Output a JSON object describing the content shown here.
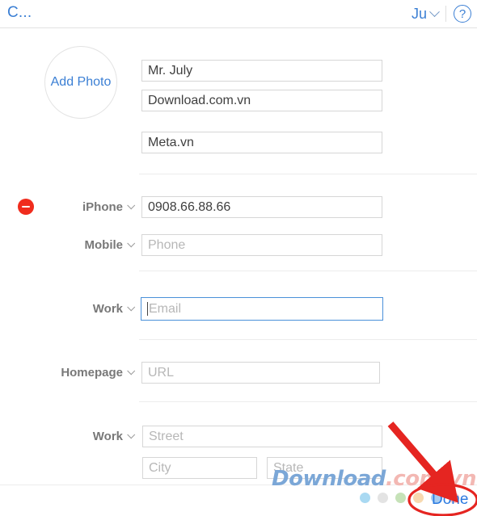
{
  "header": {
    "title": "C...",
    "account_label": "Ju",
    "account_chevron_icon": "chevron-down-icon",
    "help_icon": "help-circle-icon"
  },
  "photo": {
    "label": "Add Photo"
  },
  "name_fields": [
    {
      "name": "first-name-field",
      "value": "Mr. July"
    },
    {
      "name": "last-name-field",
      "value": "Download.com.vn"
    },
    {
      "name": "company-field",
      "value": "Meta.vn"
    }
  ],
  "phone_section": {
    "delete_icon": "minus-circle-icon",
    "rows": [
      {
        "label": "iPhone",
        "value": "0908.66.88.66",
        "placeholder": "",
        "is_placeholder": false
      },
      {
        "label": "Mobile",
        "value": "Phone",
        "placeholder": "Phone",
        "is_placeholder": true
      }
    ]
  },
  "email_section": {
    "rows": [
      {
        "label": "Work",
        "value": "Email",
        "placeholder": "Email",
        "is_placeholder": true,
        "focused": true
      }
    ]
  },
  "url_section": {
    "rows": [
      {
        "label": "Homepage",
        "value": "URL",
        "placeholder": "URL",
        "is_placeholder": true
      }
    ]
  },
  "address_section": {
    "label": "Work",
    "street_placeholder": "Street",
    "city_placeholder": "City",
    "state_placeholder": "State"
  },
  "footer": {
    "done_label": "Done",
    "color_dots": [
      {
        "name": "color-dot-blue",
        "color": "#a9d9f2"
      },
      {
        "name": "color-dot-gray",
        "color": "#e3e3e3"
      },
      {
        "name": "color-dot-green",
        "color": "#c6e2b8"
      },
      {
        "name": "color-dot-orange",
        "color": "#f7d9b0"
      },
      {
        "name": "color-dot-lightblue",
        "color": "#a9cdf0"
      },
      {
        "name": "color-dot-pink",
        "color": "#f3c0c7"
      }
    ]
  },
  "watermark": {
    "text_main": "Download",
    "text_suffix": ".com.vn"
  },
  "annotations": {
    "arrow_color": "#e52521",
    "highlight_color": "#e52521"
  },
  "colors": {
    "accent_blue": "#3b7fd4",
    "focus_blue": "#4a90d9",
    "delete_red": "#f02c1d"
  }
}
